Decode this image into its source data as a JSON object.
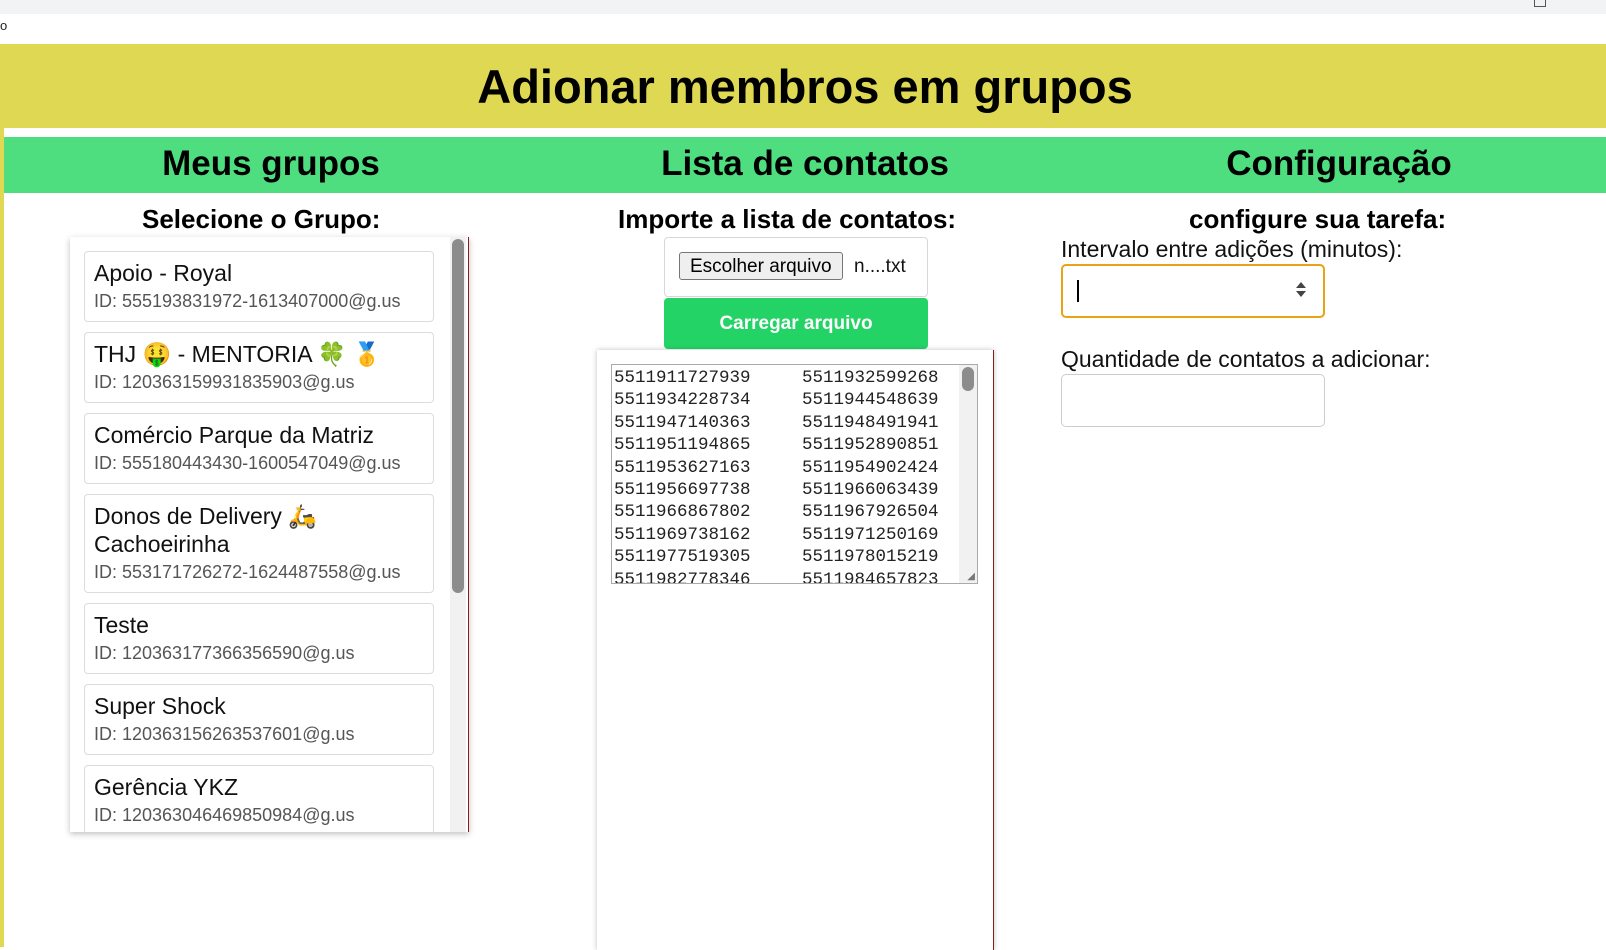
{
  "window": {
    "stray_char": "o"
  },
  "header": {
    "title": "Adionar membros em grupos"
  },
  "columns": {
    "groups": "Meus grupos",
    "contacts": "Lista de contatos",
    "config": "Configuração"
  },
  "groups_section": {
    "label": "Selecione o Grupo:",
    "items": [
      {
        "name": "Apoio - Royal",
        "id": "ID: 555193831972-1613407000@g.us"
      },
      {
        "name": "THJ 🤑 - MENTORIA 🍀 🥇",
        "id": "ID: 120363159931835903@g.us"
      },
      {
        "name": "Comércio Parque da Matriz",
        "id": "ID: 555180443430-1600547049@g.us"
      },
      {
        "name": "Donos de Delivery 🛵 Cachoeirinha",
        "id": "ID: 553171726272-1624487558@g.us"
      },
      {
        "name": "Teste",
        "id": "ID: 120363177366356590@g.us"
      },
      {
        "name": "Super Shock",
        "id": "ID: 120363156263537601@g.us"
      },
      {
        "name": "Gerência YKZ",
        "id": "ID: 120363046469850984@g.us"
      }
    ]
  },
  "contacts_section": {
    "label": "Importe a lista de contatos:",
    "choose_file_label": "Escolher arquivo",
    "file_name": "n....txt",
    "load_button": "Carregar arquivo",
    "contacts": [
      "5511911727939",
      "5511932599268",
      "5511934228734",
      "5511944548639",
      "5511947140363",
      "5511948491941",
      "5511951194865",
      "5511952890851",
      "5511953627163",
      "5511954902424",
      "5511956697738",
      "5511966063439",
      "5511966867802",
      "5511967926504",
      "5511969738162",
      "5511971250169",
      "5511977519305",
      "5511978015219",
      "5511982778346",
      "5511984657823"
    ]
  },
  "config_section": {
    "label": "configure sua tarefa:",
    "interval_label": "Intervalo entre adições (minutos):",
    "interval_value": "",
    "quantity_label": "Quantidade de contatos a adicionar:",
    "quantity_value": ""
  },
  "colors": {
    "banner": "#ded853",
    "column_header": "#4ede80",
    "load_button": "#24d366",
    "focus_border": "#e8a317"
  }
}
